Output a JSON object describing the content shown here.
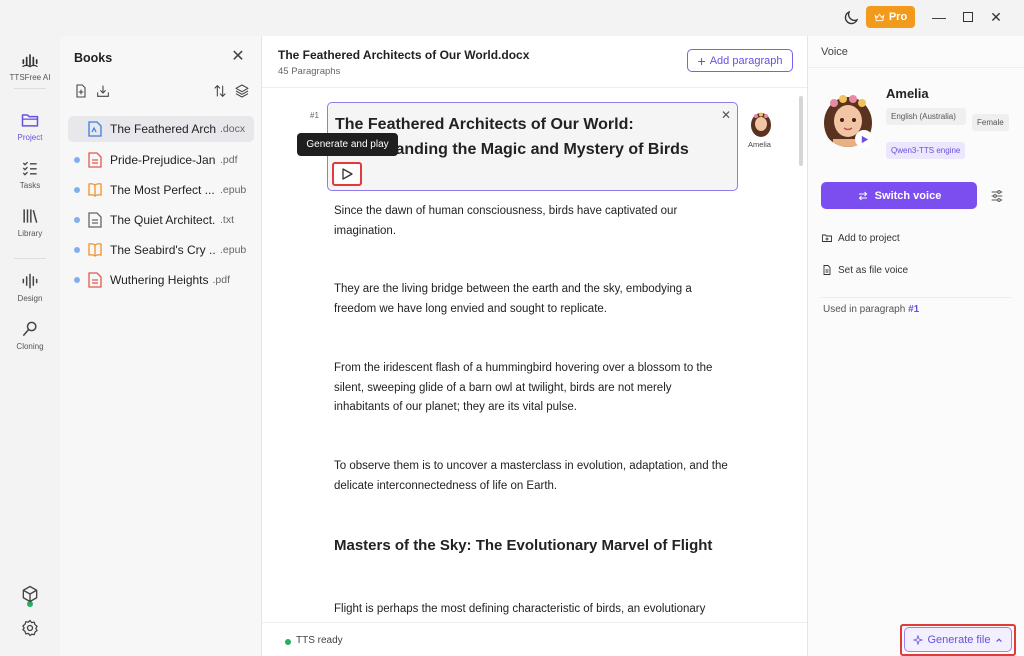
{
  "app": {
    "name": "TTSFree AI",
    "pro_label": "Pro"
  },
  "rail": [
    {
      "label": "Project",
      "icon": "folder-icon"
    },
    {
      "label": "Tasks",
      "icon": "tasks-icon"
    },
    {
      "label": "Library",
      "icon": "library-icon"
    },
    {
      "label": "Design",
      "icon": "waveform-icon"
    },
    {
      "label": "Cloning",
      "icon": "cloning-icon"
    }
  ],
  "books": {
    "title": "Books",
    "items": [
      {
        "name": "The Feathered Arch...",
        "ext": ".docx",
        "type": "docx"
      },
      {
        "name": "Pride-Prejudice-Jan...",
        "ext": ".pdf",
        "type": "pdf"
      },
      {
        "name": "The Most Perfect ...",
        "ext": ".epub",
        "type": "epub"
      },
      {
        "name": "The Quiet Architect...",
        "ext": ".txt",
        "type": "txt"
      },
      {
        "name": "The Seabird's Cry ...",
        "ext": ".epub",
        "type": "epub"
      },
      {
        "name": "Wuthering Heights",
        "ext": ".pdf",
        "type": "pdf"
      }
    ]
  },
  "editor": {
    "doc_title": "The Feathered Architects of Our World.docx",
    "paragraph_count": "45 Paragraphs",
    "add_paragraph": "Add paragraph",
    "para_number": "#1",
    "heading": "The Feathered Architects of Our World: Understanding the Magic and Mystery of Birds",
    "tooltip": "Generate and play",
    "voice_name": "Amelia",
    "paragraphs": [
      "Since the dawn of human consciousness, birds have captivated our imagination.",
      "They are the living bridge between the earth and the sky, embodying a freedom we have long envied and sought to replicate.",
      "From the iridescent flash of a hummingbird hovering over a blossom to the silent, sweeping glide of a barn owl at twilight, birds are not merely inhabitants of our planet; they are its vital pulse.",
      "To observe them is to uncover a masterclass in evolution, adaptation, and the delicate interconnectedness of life on Earth."
    ],
    "subheading": "Masters of the Sky: The Evolutionary Marvel of Flight",
    "last_paragraph": "Flight is perhaps the most defining characteristic of birds, an evolutionary",
    "status": "TTS ready"
  },
  "voice": {
    "title": "Voice",
    "name": "Amelia",
    "language": "English (Australia)",
    "gender": "Female",
    "engine": "Qwen3-TTS engine",
    "switch_label": "Switch voice",
    "add_to_project": "Add to project",
    "set_file_voice": "Set as file voice",
    "used_in_label": "Used in paragraph",
    "used_in_value": "#1"
  },
  "generate_file": "Generate file",
  "colors": {
    "accent": "#7c4ef0",
    "pro": "#f29a1b",
    "highlight": "#e23a3a",
    "ready": "#27ae60"
  }
}
